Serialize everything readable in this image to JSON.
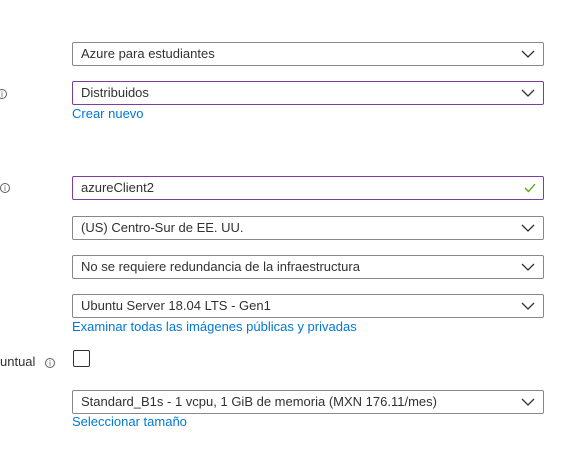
{
  "fields": {
    "subscription": {
      "value": "Azure para estudiantes"
    },
    "resource_group": {
      "value": "Distribuidos",
      "link": "Crear nuevo"
    },
    "vm_name": {
      "value": "azureClient2"
    },
    "region": {
      "value": "(US) Centro-Sur de EE. UU."
    },
    "availability": {
      "value": "No se requiere redundancia de la infraestructura"
    },
    "image": {
      "value": "Ubuntu Server 18.04 LTS - Gen1",
      "link": "Examinar todas las imágenes públicas y privadas"
    },
    "spot": {
      "label": "untual",
      "checked": false
    },
    "size": {
      "value": "Standard_B1s - 1 vcpu, 1 GiB de memoria (MXN 176.11/mes)",
      "link": "Seleccionar tamaño"
    }
  },
  "colors": {
    "accent_border": "#7a3e9d",
    "link": "#0078d4",
    "valid_check": "#57a300"
  },
  "icons": {
    "info": "info-icon",
    "dropdown": "chevron-down-icon",
    "valid": "checkmark-icon"
  }
}
